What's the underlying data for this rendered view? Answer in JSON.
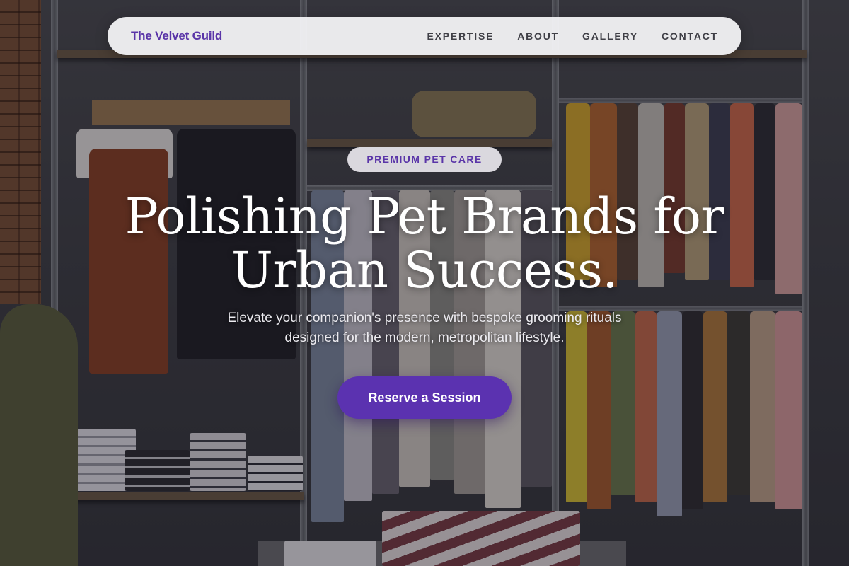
{
  "brand": {
    "name": "The Velvet Guild",
    "color": "#5a35a8"
  },
  "nav": {
    "items": [
      {
        "label": "EXPERTISE"
      },
      {
        "label": "ABOUT"
      },
      {
        "label": "GALLERY"
      },
      {
        "label": "CONTACT"
      }
    ]
  },
  "hero": {
    "badge": "PREMIUM PET CARE",
    "headline_line1": "Polishing Pet Brands for",
    "headline_line2": "Urban Success.",
    "subheadline_line1": "Elevate your companion's presence with bespoke grooming rituals",
    "subheadline_line2": "designed for the modern, metropolitan lifestyle.",
    "cta_label": "Reserve a Session",
    "cta_color": "#5b32b0"
  },
  "background": {
    "description_icon": "clothing-store-photo"
  }
}
